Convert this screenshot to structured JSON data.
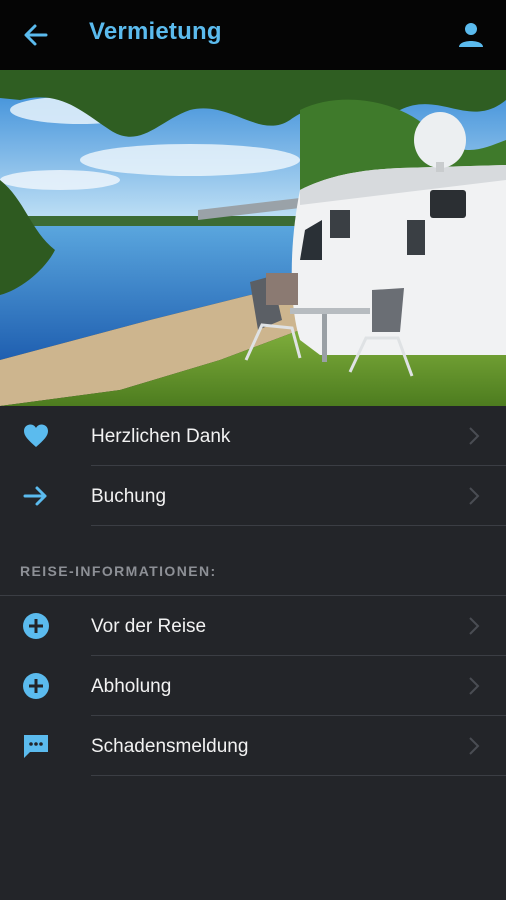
{
  "header": {
    "title": "Vermietung",
    "back_icon": "arrow-left-icon",
    "profile_icon": "person-icon",
    "accent_color": "#5bbbee",
    "background_color": "#050505"
  },
  "hero": {
    "image_subject": "motorhome-at-lakeside"
  },
  "main_items": [
    {
      "label": "Herzlichen Dank",
      "icon": "heart-icon"
    },
    {
      "label": "Buchung",
      "icon": "arrow-right-icon"
    }
  ],
  "section": {
    "title": "REISE-INFORMATIONEN:"
  },
  "info_items": [
    {
      "label": "Vor der Reise",
      "icon": "plus-circle-icon"
    },
    {
      "label": "Abholung",
      "icon": "plus-circle-icon"
    },
    {
      "label": "Schadensmeldung",
      "icon": "message-icon"
    }
  ],
  "colors": {
    "background": "#232529",
    "divider": "#3b3e44",
    "section_title": "#8d9096",
    "icon": "#5bbbee"
  }
}
